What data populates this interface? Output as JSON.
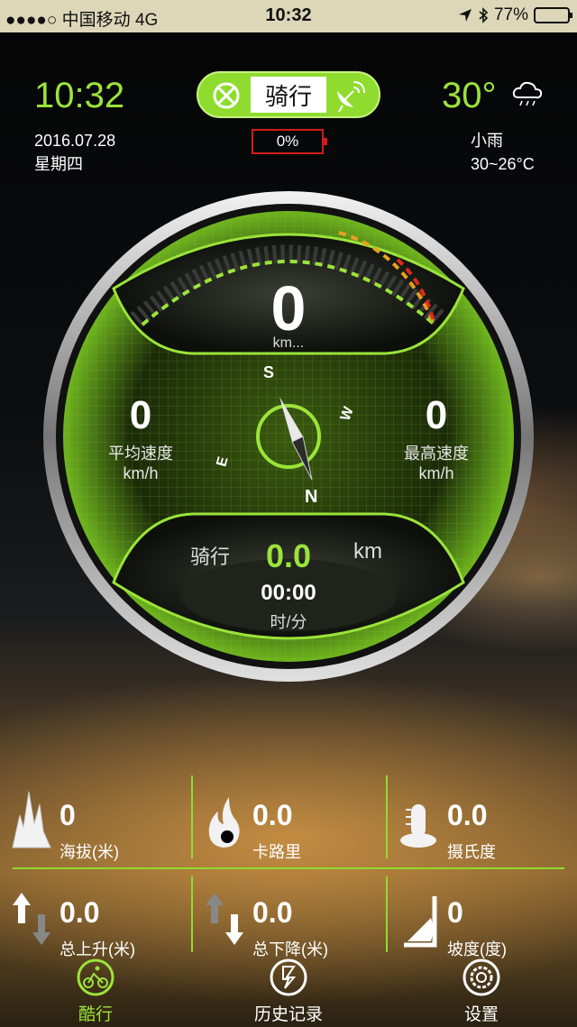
{
  "status_bar": {
    "carrier": "●●●●○ 中国移动   4G",
    "time": "10:32",
    "battery_percent": "77%",
    "battery_level": 0.77
  },
  "header": {
    "clock": "10:32",
    "date": "2016.07.28",
    "weekday": "星期四",
    "temperature": "30°",
    "weather_desc": "小雨",
    "temp_range": "30~26°C",
    "weather_icon": "cloud-rain-icon",
    "mode_label": "骑行",
    "device_battery": "0%"
  },
  "gauge": {
    "speed_value": "0",
    "speed_unit": "km...",
    "avg_speed_value": "0",
    "avg_speed_label": "平均速度",
    "avg_speed_unit": "km/h",
    "max_speed_value": "0",
    "max_speed_label": "最高速度",
    "max_speed_unit": "km/h",
    "compass": {
      "n": "N",
      "s": "S",
      "e": "E",
      "w": "W"
    },
    "ride_label": "骑行",
    "distance_value": "0.0",
    "distance_unit": "km",
    "duration_value": "00:00",
    "duration_unit": "时/分"
  },
  "stats": [
    {
      "value": "0",
      "label": "海拔(米)",
      "icon": "mountain-icon"
    },
    {
      "value": "0.0",
      "label": "卡路里",
      "icon": "flame-icon"
    },
    {
      "value": "0.0",
      "label": "摄氏度",
      "icon": "thermometer-icon"
    },
    {
      "value": "0.0",
      "label": "总上升(米)",
      "icon": "arrow-up-icon"
    },
    {
      "value": "0.0",
      "label": "总下降(米)",
      "icon": "arrow-down-icon"
    },
    {
      "value": "0",
      "label": "坡度(度)",
      "icon": "slope-icon"
    }
  ],
  "tabs": [
    {
      "label": "酷行",
      "icon": "bike-icon",
      "active": true
    },
    {
      "label": "历史记录",
      "icon": "history-icon",
      "active": false
    },
    {
      "label": "设置",
      "icon": "settings-icon",
      "active": false
    }
  ],
  "colors": {
    "accent": "#9be33a",
    "battery_alert": "#d21c1c",
    "status_bar_bg": "#ddd6b8"
  }
}
